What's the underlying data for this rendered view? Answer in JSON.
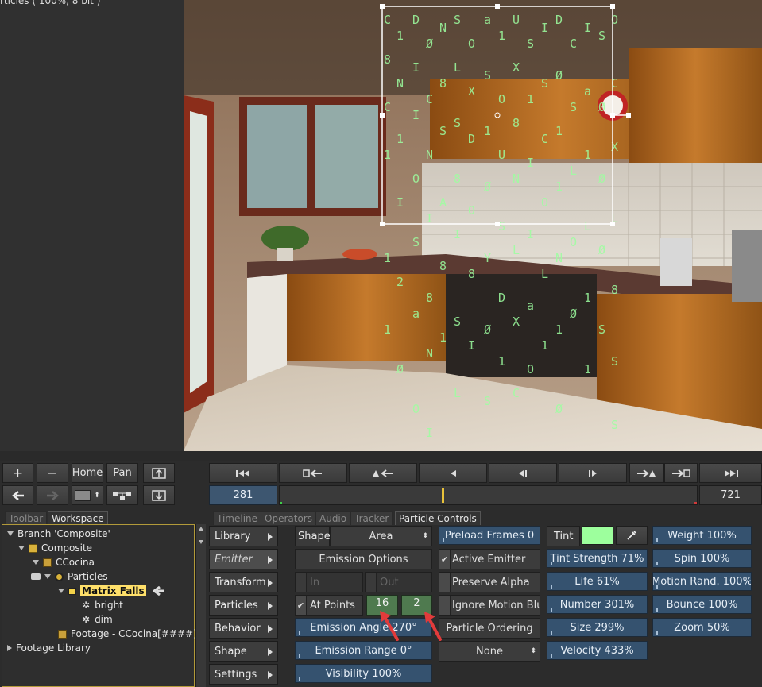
{
  "viewer": {
    "title": "rticles ( 100%, 8 bit )"
  },
  "nav_buttons": {
    "add": "+",
    "remove": "−",
    "home": "Home",
    "pan": "Pan"
  },
  "timeline": {
    "current_frame": "281",
    "end_frame": "721",
    "playhead_fraction": 0.39
  },
  "tabs": {
    "left": [
      "Toolbar",
      "Workspace"
    ],
    "right": [
      "Timeline",
      "Operators",
      "Audio",
      "Tracker",
      "Particle Controls"
    ],
    "left_active": "Workspace",
    "right_active": "Particle Controls"
  },
  "tree": {
    "branch": "Branch 'Composite'",
    "composite": "Composite",
    "ccocina": "CCocina",
    "particles": "Particles",
    "matrix_falls": "Matrix Falls",
    "bright": "bright",
    "dim": "dim",
    "footage": "Footage - CCocina[####]",
    "footage_library": "Footage Library"
  },
  "side_menu": [
    "Library",
    "Emitter",
    "Transform",
    "Particles",
    "Behavior",
    "Shape",
    "Settings"
  ],
  "side_menu_active": "Emitter",
  "emitter": {
    "shape_label": "Shape",
    "shape_value": "Area",
    "emission_options": "Emission Options",
    "in_label": "In",
    "out_label": "Out",
    "at_points": "At Points",
    "points_x": "16",
    "points_y": "2",
    "emission_angle": "Emission Angle 270°",
    "emission_range": "Emission Range 0°",
    "visibility": "Visibility 100%",
    "preload_frames": "Preload Frames 0",
    "active_emitter": "Active Emitter",
    "preserve_alpha": "Preserve Alpha",
    "ignore_motion_blur": "Ignore Motion Blur",
    "particle_ordering": "Particle Ordering",
    "ordering_value": "None",
    "tint_label": "Tint",
    "tint_color": "#9dff9d",
    "tint_strength": "Tint Strength 71%",
    "life": "Life 61%",
    "number": "Number 301%",
    "size": "Size 299%",
    "velocity": "Velocity 433%",
    "weight": "Weight 100%",
    "spin": "Spin 100%",
    "motion_rand": "Motion Rand. 100%",
    "bounce": "Bounce 100%",
    "zoom": "Zoom 50%"
  },
  "colors": {
    "panel_bg": "#2c2c2c",
    "blue_field": "#35526f",
    "green_field": "#4f7a4f",
    "selection_border": "#b29a3a",
    "highlight": "#ffe06a",
    "annotation_arrow": "#e23b3b"
  }
}
